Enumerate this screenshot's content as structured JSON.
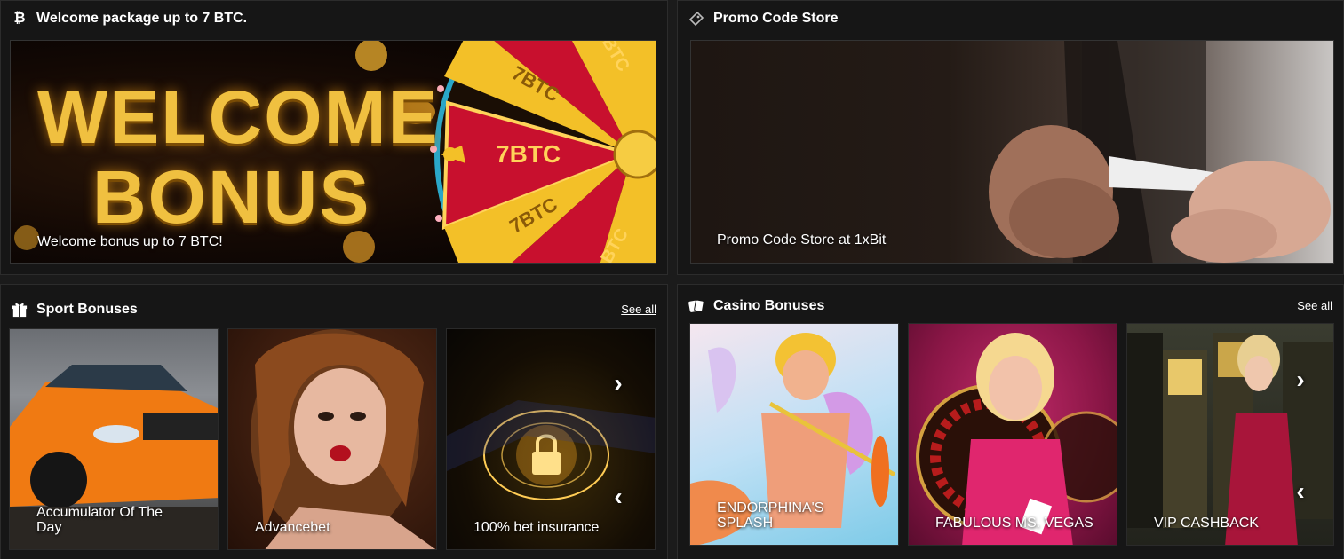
{
  "welcome": {
    "header_title": "Welcome package up to 7 BTC.",
    "header_icon": "bitcoin-icon",
    "banner_line1": "WELCOME",
    "banner_line2": "BONUS",
    "wheel_labels": [
      "7BTC",
      "7BTC",
      "7BTC",
      "BTC",
      "BTC"
    ],
    "caption": "Welcome bonus up to 7 BTC!"
  },
  "promo": {
    "header_title": "Promo Code Store",
    "header_icon": "ticket-icon",
    "caption": "Promo Code Store at 1xBit"
  },
  "sport": {
    "header_title": "Sport Bonuses",
    "header_icon": "gift-icon",
    "see_all": "See all",
    "cards": [
      {
        "label": "Accumulator Of The Day"
      },
      {
        "label": "Advancebet"
      },
      {
        "label": "100% bet insurance"
      }
    ]
  },
  "casino": {
    "header_title": "Casino Bonuses",
    "header_icon": "cards-icon",
    "see_all": "See all",
    "cards": [
      {
        "label": "ENDORPHINA'S SPLASH"
      },
      {
        "label": "FABULOUS MS. VEGAS"
      },
      {
        "label": "VIP CASHBACK"
      }
    ]
  },
  "colors": {
    "background": "#1b1b1b",
    "panel": "#161616",
    "gold": "#e8b63a",
    "wheel_red": "#c8102e"
  }
}
